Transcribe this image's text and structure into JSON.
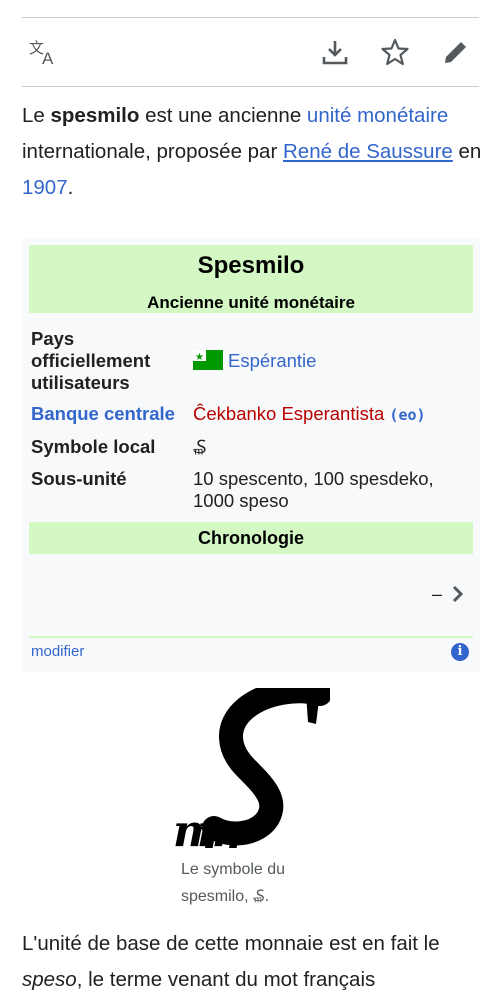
{
  "toolbar": {
    "language_icon": "translate-icon",
    "download_icon": "download-icon",
    "star_icon": "star-icon",
    "edit_icon": "pencil-icon"
  },
  "lead": {
    "p1": "Le ",
    "bold": "spesmilo",
    "p2": " est une ancienne ",
    "link1": "unité monétaire",
    "p3": " internationale, proposée par ",
    "link2": "René de Saussure",
    "p4": " en ",
    "link3": "1907",
    "p5": "."
  },
  "infobox": {
    "title": "Spesmilo",
    "subtitle": "Ancienne unité monétaire",
    "rows": [
      {
        "label": "Pays officiellement utilisateurs",
        "value": "Espérantie"
      },
      {
        "label": "Banque centrale",
        "value": "Ĉekbanko Esperantista",
        "code": "(eo)"
      },
      {
        "label": "Symbole local",
        "value": "₷"
      },
      {
        "label": "Sous-unité",
        "value": "10 spescento, 100 spesdeko, 1000 speso"
      }
    ],
    "chronology": "Chronologie",
    "dash": "–",
    "modifier": "modifier",
    "info": "i"
  },
  "figure": {
    "caption": "Le symbole du spesmilo, ₷."
  },
  "para": {
    "p1": "L'unité de base de cette monnaie est en fait le ",
    "italic": "speso",
    "p2": ", le terme venant du mot français"
  },
  "colors": {
    "link": "#3366cc",
    "redlink": "#ba0000",
    "infobox_header": "#d4f8c4",
    "infobox_bg": "#f8f9fa"
  }
}
